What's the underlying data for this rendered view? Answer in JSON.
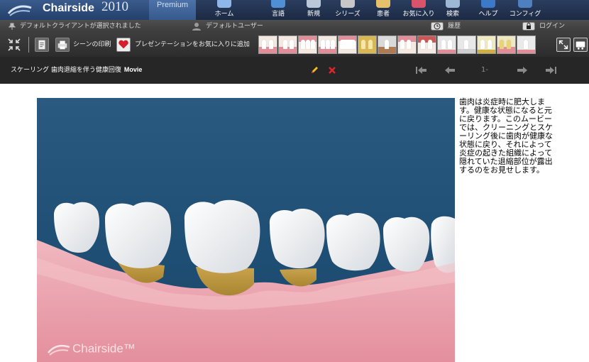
{
  "brand": {
    "name": "Chairside",
    "year": "2010",
    "edition": "Premium"
  },
  "nav": [
    {
      "label": "ホーム",
      "icon": "home-icon",
      "color": "#8fb6e8"
    },
    {
      "label": "言語",
      "icon": "globe-icon",
      "color": "#4f8fd6"
    },
    {
      "label": "新規",
      "icon": "new-icon",
      "color": "#b9c7d8"
    },
    {
      "label": "シリーズ",
      "icon": "film-icon",
      "color": "#c7c7c7"
    },
    {
      "label": "患者",
      "icon": "patient-icon",
      "color": "#e6c16b"
    },
    {
      "label": "お気に入り",
      "icon": "heart-icon",
      "color": "#d9546a"
    },
    {
      "label": "検索",
      "icon": "search-icon",
      "color": "#9cb8d4"
    },
    {
      "label": "ヘルプ",
      "icon": "help-icon",
      "color": "#3d79c9"
    },
    {
      "label": "コンフィグ",
      "icon": "gear-icon",
      "color": "#4e7fbf"
    }
  ],
  "status": {
    "client": "デフォルトクライアントが選択されました",
    "user": "デフォルトユーザー",
    "history": "履歴",
    "login": "ログイン"
  },
  "toolbar": {
    "print_scene": "シーンの印刷",
    "add_presentation_favorite": "プレゼンテーションをお気に入りに追加"
  },
  "titlebar": {
    "title": "スケーリング  歯肉退縮を伴う健康回復",
    "type": "Movie",
    "page_count": "1-1"
  },
  "description": "歯肉は炎症時に肥大します。健康な状態になると元に戻ります。このムービーでは、クリーニングとスケーリング後に歯肉が健康な状態に戻り、それによって炎症の起きた組織によって隠れていた退縮部位が露出するのをお見せします。",
  "watermark": "Chairside™",
  "colors": {
    "accent": "#d3202a",
    "video_background": "#1f4e74",
    "gum": "#e8a3ad",
    "root": "#c9a24c"
  }
}
